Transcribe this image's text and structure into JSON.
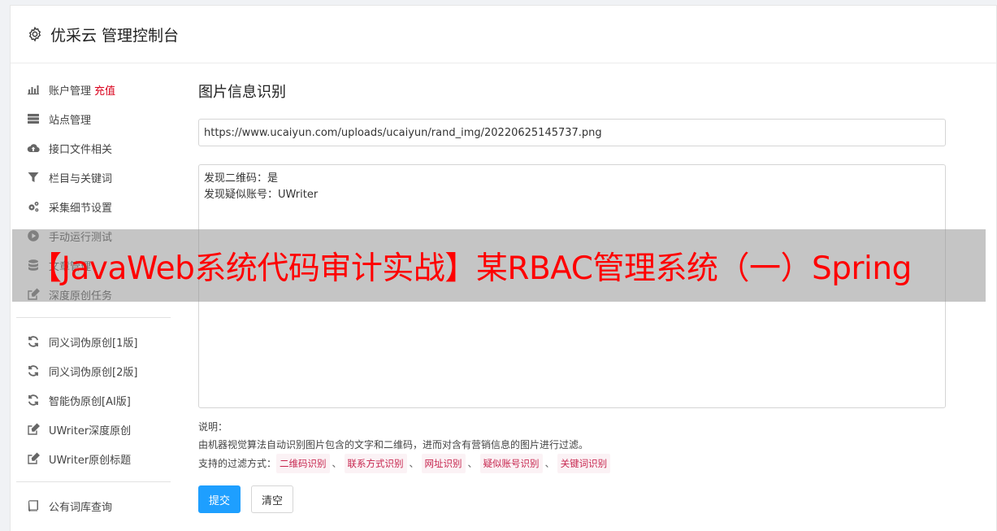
{
  "header": {
    "title": "优采云 管理控制台",
    "icon": "gear-icon"
  },
  "sidebar": {
    "group1": [
      {
        "label": "账户管理",
        "extra": "充值",
        "icon": "bar-chart-icon"
      },
      {
        "label": "站点管理",
        "icon": "server-icon"
      },
      {
        "label": "接口文件相关",
        "icon": "cloud-upload-icon"
      },
      {
        "label": "栏目与关键词",
        "icon": "filter-icon"
      },
      {
        "label": "采集细节设置",
        "icon": "gears-icon"
      },
      {
        "label": "手动运行测试",
        "icon": "play-circle-icon"
      },
      {
        "label": "文章管理",
        "icon": "database-icon"
      },
      {
        "label": "深度原创任务",
        "icon": "edit-icon"
      }
    ],
    "group2": [
      {
        "label": "同义词伪原创[1版]",
        "icon": "refresh-icon"
      },
      {
        "label": "同义词伪原创[2版]",
        "icon": "refresh-icon"
      },
      {
        "label": "智能伪原创[AI版]",
        "icon": "refresh-icon"
      },
      {
        "label": "UWriter深度原创",
        "icon": "edit-icon"
      },
      {
        "label": "UWriter原创标题",
        "icon": "edit-icon"
      }
    ],
    "group3": [
      {
        "label": "公有词库查询",
        "icon": "book-icon"
      }
    ]
  },
  "main": {
    "title": "图片信息识别",
    "url_value": "https://www.ucaiyun.com/uploads/ucaiyun/rand_img/20220625145737.png",
    "result_lines": [
      "发现二维码：是",
      "发现疑似账号：UWriter"
    ],
    "notes_label": "说明：",
    "notes_desc": "由机器视觉算法自动识别图片包含的文字和二维码，进而对含有营销信息的图片进行过滤。",
    "filters_label": "支持的过滤方式：",
    "filters": [
      "二维码识别",
      "联系方式识别",
      "网址识别",
      "疑似账号识别",
      "关键词识别"
    ],
    "filters_sep": "、",
    "submit_label": "提交",
    "clear_label": "清空"
  },
  "banner": {
    "text": "【JavaWeb系统代码审计实战】某RBAC管理系统（一）Spring"
  },
  "colors": {
    "accent": "#1e9fff",
    "danger": "#d9001b",
    "tag_text": "#c7254e",
    "tag_bg": "#fbf2f5",
    "banner_text": "#ff0000"
  }
}
